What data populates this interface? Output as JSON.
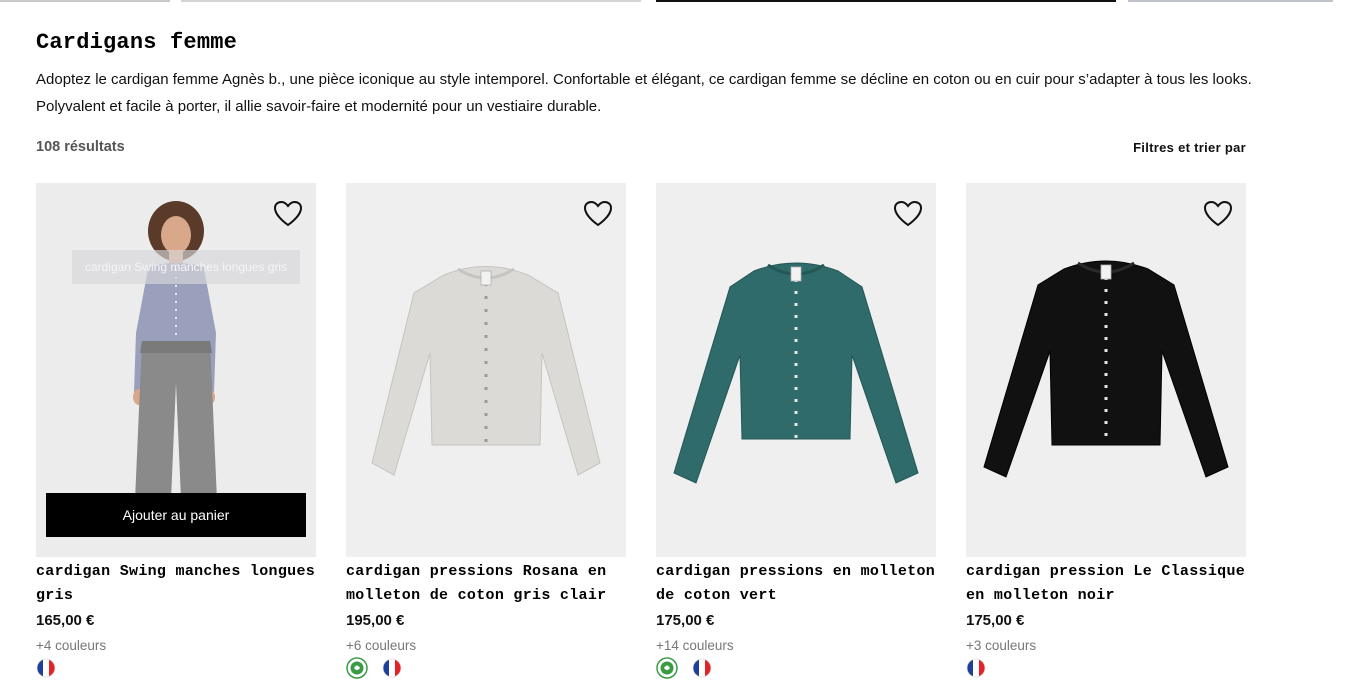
{
  "page": {
    "title": "Cardigans femme",
    "description": "Adoptez le cardigan femme Agnès b., une pièce iconique au style intemporel. Confortable et élégant, ce cardigan femme se décline en coton ou en cuir pour s’adapter à tous les looks. Polyvalent et facile à porter, il allie savoir-faire et modernité pour un vestiaire durable.",
    "results_count": "108 résultats",
    "filters_label": "Filtres et trier par"
  },
  "colors": {
    "accent": "#000000",
    "card_background": "#efefef",
    "muted_text": "#777777",
    "organic_badge": "#3a9b45",
    "flag_blue": "#1f3f9a",
    "flag_red": "#e2232a"
  },
  "products": [
    {
      "name": "cardigan Swing manches longues gris",
      "price": "165,00 €",
      "colors_count": "+4 couleurs",
      "image_caption": "cardigan Swing manches longues gris",
      "add_to_cart_label": "Ajouter au panier",
      "garment_color": "#9aa0bb",
      "badges": [
        "french-flag-icon"
      ]
    },
    {
      "name": "cardigan pressions Rosana en molleton de coton gris clair",
      "price": "195,00 €",
      "colors_count": "+6 couleurs",
      "garment_color": "#dcdad6",
      "badges": [
        "organic-cotton-icon",
        "french-flag-icon"
      ]
    },
    {
      "name": "cardigan pressions en molleton de coton vert",
      "price": "175,00 €",
      "colors_count": "+14 couleurs",
      "garment_color": "#2e6b6a",
      "badges": [
        "organic-cotton-icon",
        "french-flag-icon"
      ]
    },
    {
      "name": "cardigan pression Le Classique en molleton noir",
      "price": "175,00 €",
      "colors_count": "+3 couleurs",
      "garment_color": "#111111",
      "badges": [
        "french-flag-icon"
      ]
    }
  ]
}
